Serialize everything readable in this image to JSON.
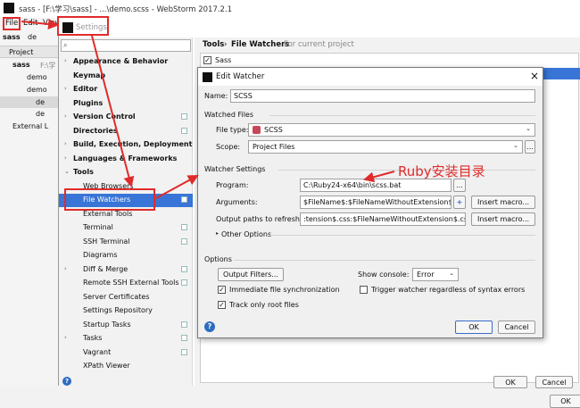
{
  "window": {
    "title": "sass - [F:\\学习\\sass] - ...\\demo.scss - WebStorm 2017.2.1"
  },
  "menu": {
    "file": "File",
    "edit": "Edit",
    "view": "View"
  },
  "project_panel": {
    "breadcrumb_root": "sass",
    "breadcrumb_child": "de",
    "tab": "Project",
    "tree": [
      {
        "label": "sass",
        "suffix": "F:\\学"
      },
      {
        "label": "demo"
      },
      {
        "label": "demo"
      },
      {
        "label": "de"
      },
      {
        "label": "de"
      },
      {
        "label": "External L"
      }
    ]
  },
  "settings": {
    "title": "Settings",
    "search_placeholder": "",
    "breadcrumb": {
      "parent": "Tools",
      "sep": "›",
      "current": "File Watchers",
      "scope": "For current project"
    },
    "tree": [
      {
        "label": "Appearance & Behavior",
        "bold": true,
        "arrow": "›"
      },
      {
        "label": "Keymap",
        "bold": true
      },
      {
        "label": "Editor",
        "bold": true,
        "arrow": "›"
      },
      {
        "label": "Plugins",
        "bold": true
      },
      {
        "label": "Version Control",
        "bold": true,
        "arrow": "›"
      },
      {
        "label": "Directories",
        "bold": true
      },
      {
        "label": "Build, Execution, Deployment",
        "bold": true,
        "arrow": "›"
      },
      {
        "label": "Languages & Frameworks",
        "bold": true,
        "arrow": "›"
      },
      {
        "label": "Tools",
        "bold": true,
        "arrow": "⌄"
      },
      {
        "label": "Web Browsers"
      },
      {
        "label": "File Watchers",
        "selected": true
      },
      {
        "label": "External Tools"
      },
      {
        "label": "Terminal"
      },
      {
        "label": "SSH Terminal"
      },
      {
        "label": "Diagrams"
      },
      {
        "label": "Diff & Merge",
        "arrow": "›"
      },
      {
        "label": "Remote SSH External Tools"
      },
      {
        "label": "Server Certificates"
      },
      {
        "label": "Settings Repository"
      },
      {
        "label": "Startup Tasks"
      },
      {
        "label": "Tasks",
        "arrow": "›"
      },
      {
        "label": "Vagrant"
      },
      {
        "label": "XPath Viewer"
      }
    ],
    "watchers": [
      {
        "label": "Sass",
        "checked": true
      }
    ],
    "ok": "OK",
    "cancel": "Cancel"
  },
  "dialog": {
    "title": "Edit Watcher",
    "close": "×",
    "name_label": "Name:",
    "name_value": "SCSS",
    "watched_files": "Watched Files",
    "file_type_label": "File type:",
    "file_type_value": "SCSS",
    "scope_label": "Scope:",
    "scope_value": "Project Files",
    "scope_more": "...",
    "watcher_settings": "Watcher Settings",
    "program_label": "Program:",
    "program_value": "C:\\Ruby24-x64\\bin\\scss.bat",
    "program_more": "...",
    "arguments_label": "Arguments:",
    "arguments_value": "$FileName$:$FileNameWithoutExtension$.css",
    "arguments_plus": "+",
    "output_label": "Output paths to refresh:",
    "output_value": ":tension$.css:$FileNameWithoutExtension$.css.map",
    "insert_macro": "Insert macro...",
    "other_options": "Other Options",
    "options": "Options",
    "output_filters": "Output Filters...",
    "show_console_label": "Show console:",
    "show_console_value": "Error",
    "immediate_sync": "Immediate file synchronization",
    "trigger_label": "Trigger watcher regardless of syntax errors",
    "track_root": "Track only root files",
    "ok": "OK",
    "cancel": "Cancel"
  },
  "annotation": {
    "text": "Ruby安装目录",
    "color": "#e02b2b"
  }
}
